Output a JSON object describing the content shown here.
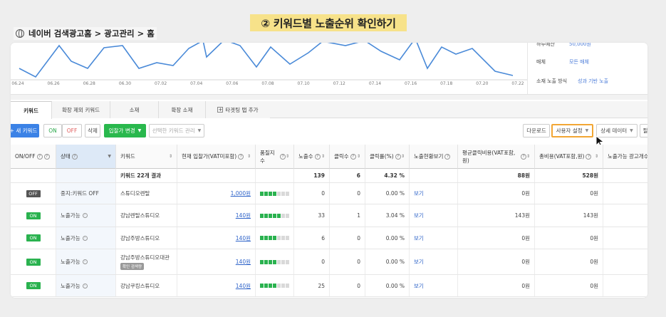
{
  "banner": {
    "title": "② 키워드별 노출순위 확인하기"
  },
  "breadcrumb": {
    "text": "네이버 검색광고홈 > 광고관리 > 홈"
  },
  "chart_data": {
    "type": "line",
    "x": [
      "06.24",
      "06.26",
      "06.28",
      "06.30",
      "07.02",
      "07.04",
      "07.06",
      "07.08",
      "07.10",
      "07.12",
      "07.14",
      "07.16",
      "07.18",
      "07.20",
      "07.22"
    ],
    "color": "#4a8ad8"
  },
  "side_panel": {
    "rows": [
      {
        "key": "하루예산",
        "value": "50,000원"
      },
      {
        "key": "매체",
        "value": "모든 매체"
      },
      {
        "key": "소재 노출 방식",
        "value": "성과 기반 노출"
      }
    ]
  },
  "tabs": [
    {
      "label": "키워드"
    },
    {
      "label": "확장 제외 키워드"
    },
    {
      "label": "소재"
    },
    {
      "label": "확장 소재"
    },
    {
      "label": "타겟팅 탭 추가"
    }
  ],
  "toolbar": {
    "new_keyword": "+ 새 키워드",
    "on": "ON",
    "off": "OFF",
    "delete": "삭제",
    "bid_change": "입찰가 변경",
    "selected_manage": "선택한 키워드 관리",
    "download": "다운로드",
    "custom_settings": "사용자 설정",
    "detail_data": "상세 데이터",
    "filter": "필"
  },
  "table": {
    "headers": [
      "ON/OFF",
      "상태",
      "키워드",
      "현재 입찰가(VAT미포함)",
      "품질지수",
      "노출수",
      "클릭수",
      "클릭률(%)",
      "노출현황보기",
      "평균클릭비용(VAT포함,원)",
      "총비용(VAT포함,원)",
      "노출가능 광고개수"
    ],
    "summary": {
      "label": "키워드 22개 결과",
      "impressions": "139",
      "clicks": "6",
      "ctr": "4.32 %",
      "avg_cpc": "88원",
      "total_cost": "528원"
    },
    "rows": [
      {
        "switch": "OFF",
        "status": "중지:키워드 OFF",
        "keyword": "스튜디오렌탈",
        "badge": "",
        "bid": "1,000원",
        "quality": 4,
        "impressions": "0",
        "clicks": "0",
        "ctr": "0.00 %",
        "view": "보기",
        "avg_cpc": "0원",
        "total_cost": "0원"
      },
      {
        "switch": "ON",
        "status": "노출가능",
        "keyword": "강남렌탈스튜디오",
        "badge": "",
        "bid": "140원",
        "quality": 5,
        "impressions": "33",
        "clicks": "1",
        "ctr": "3.04 %",
        "view": "보기",
        "avg_cpc": "143원",
        "total_cost": "143원"
      },
      {
        "switch": "ON",
        "status": "노출가능",
        "keyword": "강남주방스튜디오",
        "badge": "",
        "bid": "140원",
        "quality": 4,
        "impressions": "6",
        "clicks": "0",
        "ctr": "0.00 %",
        "view": "보기",
        "avg_cpc": "0원",
        "total_cost": "0원"
      },
      {
        "switch": "ON",
        "status": "노출가능",
        "keyword": "강남주방스튜디오대관",
        "badge": "확인 검색량",
        "bid": "140원",
        "quality": 4,
        "impressions": "0",
        "clicks": "0",
        "ctr": "0.00 %",
        "view": "보기",
        "avg_cpc": "0원",
        "total_cost": "0원"
      },
      {
        "switch": "ON",
        "status": "노출가능",
        "keyword": "강남쿠킹스튜디오",
        "badge": "",
        "bid": "140원",
        "quality": 4,
        "impressions": "25",
        "clicks": "0",
        "ctr": "0.00 %",
        "view": "보기",
        "avg_cpc": "0원",
        "total_cost": "0원"
      }
    ]
  },
  "colors": {
    "accent": "#3b82e6",
    "on": "#2ab24f",
    "highlight": "#f2a634",
    "banner": "#f7e28a"
  }
}
